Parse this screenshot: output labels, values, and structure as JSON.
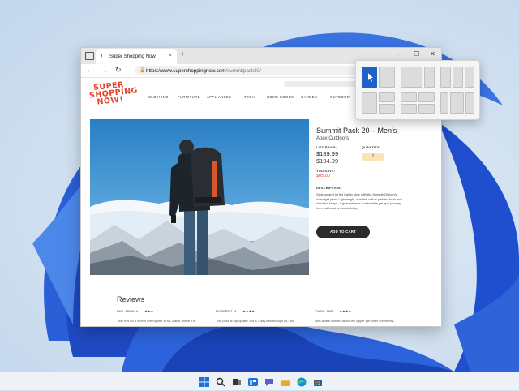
{
  "browser": {
    "tab_title": "Super Shopping Now",
    "tab_favicon": "!",
    "new_tab_label": "+",
    "close_tab_label": "×",
    "url_host": "https://www.supershoppingnow.com",
    "url_path": "/summitpack20/",
    "back_label": "←",
    "forward_label": "→",
    "refresh_label": "↻"
  },
  "window_controls": {
    "minimize": "–",
    "maximize": "☐",
    "close": "✕"
  },
  "site": {
    "logo_lines": [
      "SUPER",
      "SHOPPING",
      "NOW!"
    ],
    "nav": [
      "CLOTHING",
      "FURNITURE",
      "APPLIANCES",
      "TECH",
      "HOME GOODS",
      "GARDEN",
      "OUTDOOR"
    ]
  },
  "product": {
    "title": "Summit Pack 20 – Men's",
    "brand": "Apex Outdoors",
    "list_price_label": "LIST PRICE:",
    "price": "$189.99",
    "old_price": "$194.99",
    "you_save_label": "YOU SAVE:",
    "savings": "$05.00",
    "quantity_label": "QUANTITY:",
    "quantity": "1",
    "description_label": "DESCRIPTION:",
    "description": "Gear up and hit the trail in style with the Summit 20 men's overnight pack. Lightweight, durable, with a padded back and shoulder straps, it guarantees a comfortable yet epic journey—from trailhead to mountaintop.",
    "add_to_cart": "ADD TO CART"
  },
  "reviews": {
    "heading": "Reviews",
    "items": [
      {
        "author": "PHIL FROM IL — ★★★",
        "text": "Took this on a recent overnighter at Mt. Baker. While it fit"
      },
      {
        "author": "ROBERTO M. — ★★★★",
        "text": "This pack is top-quality. Did a 7-day trek through BC and"
      },
      {
        "author": "CHRIS 1997 — ★★★★",
        "text": "Was a little worried about the zipper per other comments,"
      }
    ]
  },
  "colors": {
    "accent": "#e0442a",
    "snap_selected": "#1c62c7",
    "cart_button": "#2b2b2b",
    "qty_bg": "#fbe3b8"
  },
  "taskbar": {
    "icons": [
      "windows-start-icon",
      "search-icon",
      "task-view-icon",
      "widgets-icon",
      "chat-icon",
      "file-explorer-icon",
      "edge-icon",
      "store-icon"
    ]
  }
}
